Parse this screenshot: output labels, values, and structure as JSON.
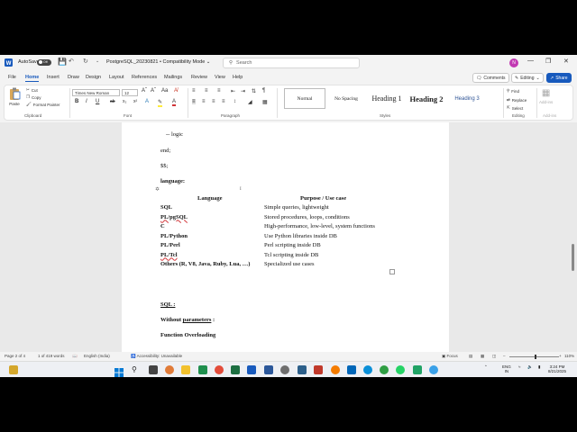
{
  "titlebar": {
    "autosave_label": "AutoSave",
    "autosave_state": "Off",
    "document_title": "PostgreSQL_20230821",
    "mode": "Compatibility Mode",
    "search_placeholder": "Search",
    "avatar_initial": "N"
  },
  "menu": {
    "tabs": [
      "File",
      "Home",
      "Insert",
      "Draw",
      "Design",
      "Layout",
      "References",
      "Mailings",
      "Review",
      "View",
      "Help"
    ],
    "active": "Home",
    "comments_label": "Comments",
    "editing_label": "Editing",
    "share_label": "Share"
  },
  "ribbon": {
    "clipboard": {
      "paste": "Paste",
      "cut": "Cut",
      "copy": "Copy",
      "format_painter": "Format Painter",
      "group": "Clipboard"
    },
    "font": {
      "name": "Times New Roman",
      "size": "12",
      "group": "Font"
    },
    "paragraph": {
      "group": "Paragraph"
    },
    "styles": {
      "items": [
        "Normal",
        "No Spacing",
        "Heading 1",
        "Heading 2",
        "Heading 3"
      ],
      "group": "Styles"
    },
    "editing": {
      "find": "Find",
      "replace": "Replace",
      "select": "Select",
      "group": "Editing"
    },
    "addins": {
      "label": "Add-ins",
      "group": "Add-ins"
    }
  },
  "document": {
    "code_lines": [
      "-- logic",
      "end;",
      "$$;"
    ],
    "language_heading": "language:",
    "table": {
      "headers": [
        "Language",
        "Purpose / Use case"
      ],
      "rows": [
        {
          "lang": "SQL",
          "purpose": "Simple queries, lightweight"
        },
        {
          "lang": "PL/pgSQL",
          "purpose": "Stored procedures, loops, conditions"
        },
        {
          "lang": "C",
          "purpose": "High-performance, low-level, system functions"
        },
        {
          "lang": "PL/Python",
          "purpose": "Use Python libraries inside DB"
        },
        {
          "lang": "PL/Perl",
          "purpose": "Perl scripting inside DB"
        },
        {
          "lang": "PL/Tcl",
          "purpose": "Tcl scripting inside DB"
        },
        {
          "lang": "Others (R, V8, Java, Ruby, Lua, …)",
          "purpose": "Specialized use cases"
        }
      ]
    },
    "sql_heading": "SQL :",
    "without_params": "Without parameters :",
    "function_overloading": "Function Overloading"
  },
  "statusbar": {
    "page": "Page 2 of 4",
    "words": "1 of 419 words",
    "language": "English (India)",
    "accessibility": "Accessibility: Unavailable",
    "focus": "Focus",
    "zoom": "110%"
  },
  "taskbar": {
    "tray_lang": "ENG",
    "tray_region": "IN",
    "time": "3:24 PM",
    "date": "8/21/2025"
  }
}
